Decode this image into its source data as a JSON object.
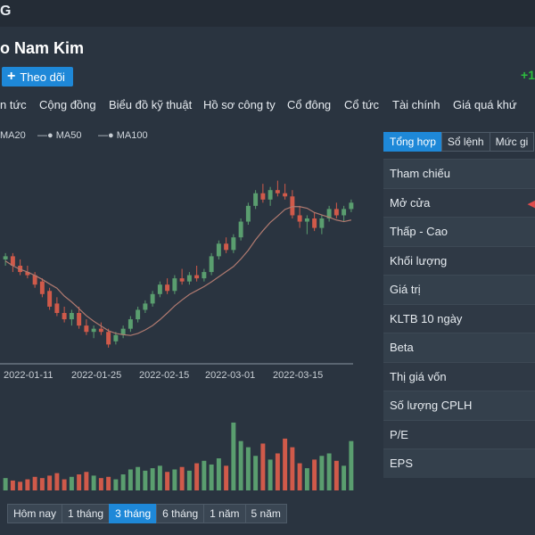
{
  "header": {
    "logo_text": "G"
  },
  "company": {
    "name": "o Nam Kim",
    "follow_label": "Theo dõi",
    "change_text": "+1"
  },
  "tabs": [
    "n tức",
    "Cộng đồng",
    "Biểu đồ kỹ thuật",
    "Hồ sơ công ty",
    "Cổ đông",
    "Cổ tức",
    "Tài chính",
    "Giá quá khứ"
  ],
  "legend": [
    "MA20",
    "MA50",
    "MA100"
  ],
  "periods": {
    "items": [
      "Hôm nay",
      "1 tháng",
      "3 tháng",
      "6 tháng",
      "1 năm",
      "5 năm"
    ],
    "active": "3 tháng"
  },
  "right_tabs": {
    "items": [
      "Tổng hợp",
      "Sổ lệnh",
      "Mức gi"
    ],
    "active": "Tổng hợp"
  },
  "stats": [
    "Tham chiếu",
    "Mở cửa",
    "Thấp - Cao",
    "Khối lượng",
    "Giá trị",
    "KLTB 10 ngày",
    "Beta",
    "Thị giá vốn",
    "Số lượng CPLH",
    "P/E",
    "EPS"
  ],
  "colors": {
    "up": "#5a9e6f",
    "down": "#d05a4a",
    "ma": "#b07a70",
    "accent": "#1e88d8"
  },
  "chart_data": {
    "type": "candlestick",
    "x_tick_labels": [
      "2022-01-11",
      "2022-01-25",
      "2022-02-15",
      "2022-03-01",
      "2022-03-15"
    ],
    "series_names": [
      "MA20",
      "MA50",
      "MA100"
    ],
    "candles_ohlc_relative": [
      [
        62,
        64,
        60,
        63
      ],
      [
        63,
        64,
        58,
        60
      ],
      [
        60,
        62,
        57,
        58
      ],
      [
        58,
        60,
        56,
        57
      ],
      [
        57,
        58,
        53,
        54
      ],
      [
        55,
        56,
        50,
        51
      ],
      [
        52,
        53,
        46,
        47
      ],
      [
        48,
        50,
        44,
        45
      ],
      [
        45,
        47,
        42,
        43
      ],
      [
        43,
        46,
        41,
        45
      ],
      [
        45,
        47,
        40,
        41
      ],
      [
        41,
        43,
        38,
        39
      ],
      [
        39,
        41,
        37,
        40
      ],
      [
        40,
        42,
        38,
        39
      ],
      [
        39,
        40,
        34,
        35
      ],
      [
        36,
        39,
        35,
        38
      ],
      [
        38,
        41,
        37,
        40
      ],
      [
        40,
        44,
        39,
        43
      ],
      [
        43,
        47,
        42,
        46
      ],
      [
        46,
        49,
        45,
        48
      ],
      [
        48,
        52,
        47,
        51
      ],
      [
        51,
        55,
        50,
        54
      ],
      [
        54,
        56,
        51,
        52
      ],
      [
        52,
        57,
        51,
        56
      ],
      [
        56,
        59,
        54,
        55
      ],
      [
        55,
        58,
        54,
        57
      ],
      [
        57,
        60,
        55,
        56
      ],
      [
        56,
        59,
        55,
        58
      ],
      [
        58,
        64,
        57,
        63
      ],
      [
        63,
        68,
        62,
        67
      ],
      [
        67,
        69,
        64,
        65
      ],
      [
        65,
        70,
        64,
        69
      ],
      [
        69,
        75,
        68,
        74
      ],
      [
        74,
        80,
        73,
        79
      ],
      [
        79,
        84,
        78,
        83
      ],
      [
        83,
        86,
        80,
        81
      ],
      [
        81,
        85,
        79,
        84
      ],
      [
        84,
        87,
        82,
        83
      ],
      [
        83,
        86,
        81,
        82
      ],
      [
        82,
        84,
        75,
        76
      ],
      [
        76,
        79,
        72,
        74
      ],
      [
        74,
        76,
        70,
        75
      ],
      [
        75,
        77,
        71,
        72
      ],
      [
        72,
        76,
        70,
        75
      ],
      [
        75,
        79,
        74,
        78
      ],
      [
        78,
        80,
        75,
        76
      ],
      [
        76,
        79,
        74,
        78
      ],
      [
        78,
        81,
        77,
        80
      ]
    ],
    "volumes_relative": [
      10,
      8,
      7,
      9,
      11,
      10,
      12,
      14,
      9,
      11,
      13,
      15,
      12,
      10,
      11,
      9,
      13,
      17,
      19,
      16,
      18,
      20,
      15,
      17,
      19,
      16,
      22,
      24,
      21,
      26,
      20,
      55,
      40,
      35,
      28,
      38,
      25,
      30,
      42,
      35,
      22,
      18,
      25,
      28,
      30,
      24,
      20,
      40
    ]
  }
}
